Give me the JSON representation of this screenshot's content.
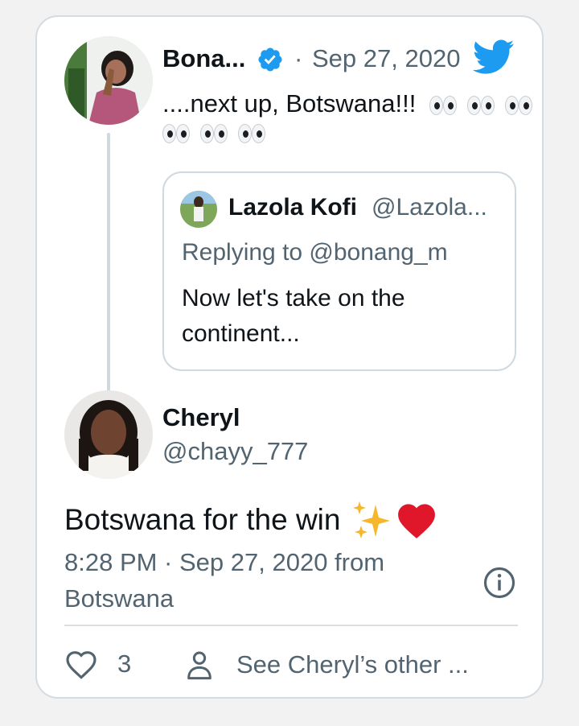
{
  "parent_tweet": {
    "author_name": "Bona...",
    "dot": "·",
    "date": "Sep 27, 2020",
    "text": "....next up, Botswana!!!",
    "eye_icon": "eyes-emoji",
    "eye_pairs_line1": 3,
    "eye_pairs_line2": 3
  },
  "quoted_tweet": {
    "author_name": "Lazola Kofi",
    "handle": "@Lazola...",
    "replying_to": "Replying to @bonang_m",
    "text": "Now let's take on the continent..."
  },
  "main_tweet": {
    "author_name": "Cheryl",
    "handle": "@chayy_777",
    "text": "Botswana for the win",
    "timestamp_line1": "8:28 PM · Sep 27, 2020 from",
    "timestamp_line2": "Botswana",
    "likes": "3",
    "see_other": "See Cheryl’s other ..."
  },
  "colors": {
    "twitter_blue": "#1d9bf0",
    "heart_red": "#e0162b",
    "sparkle_gold": "#f6b72a",
    "text_grey": "#536471"
  }
}
